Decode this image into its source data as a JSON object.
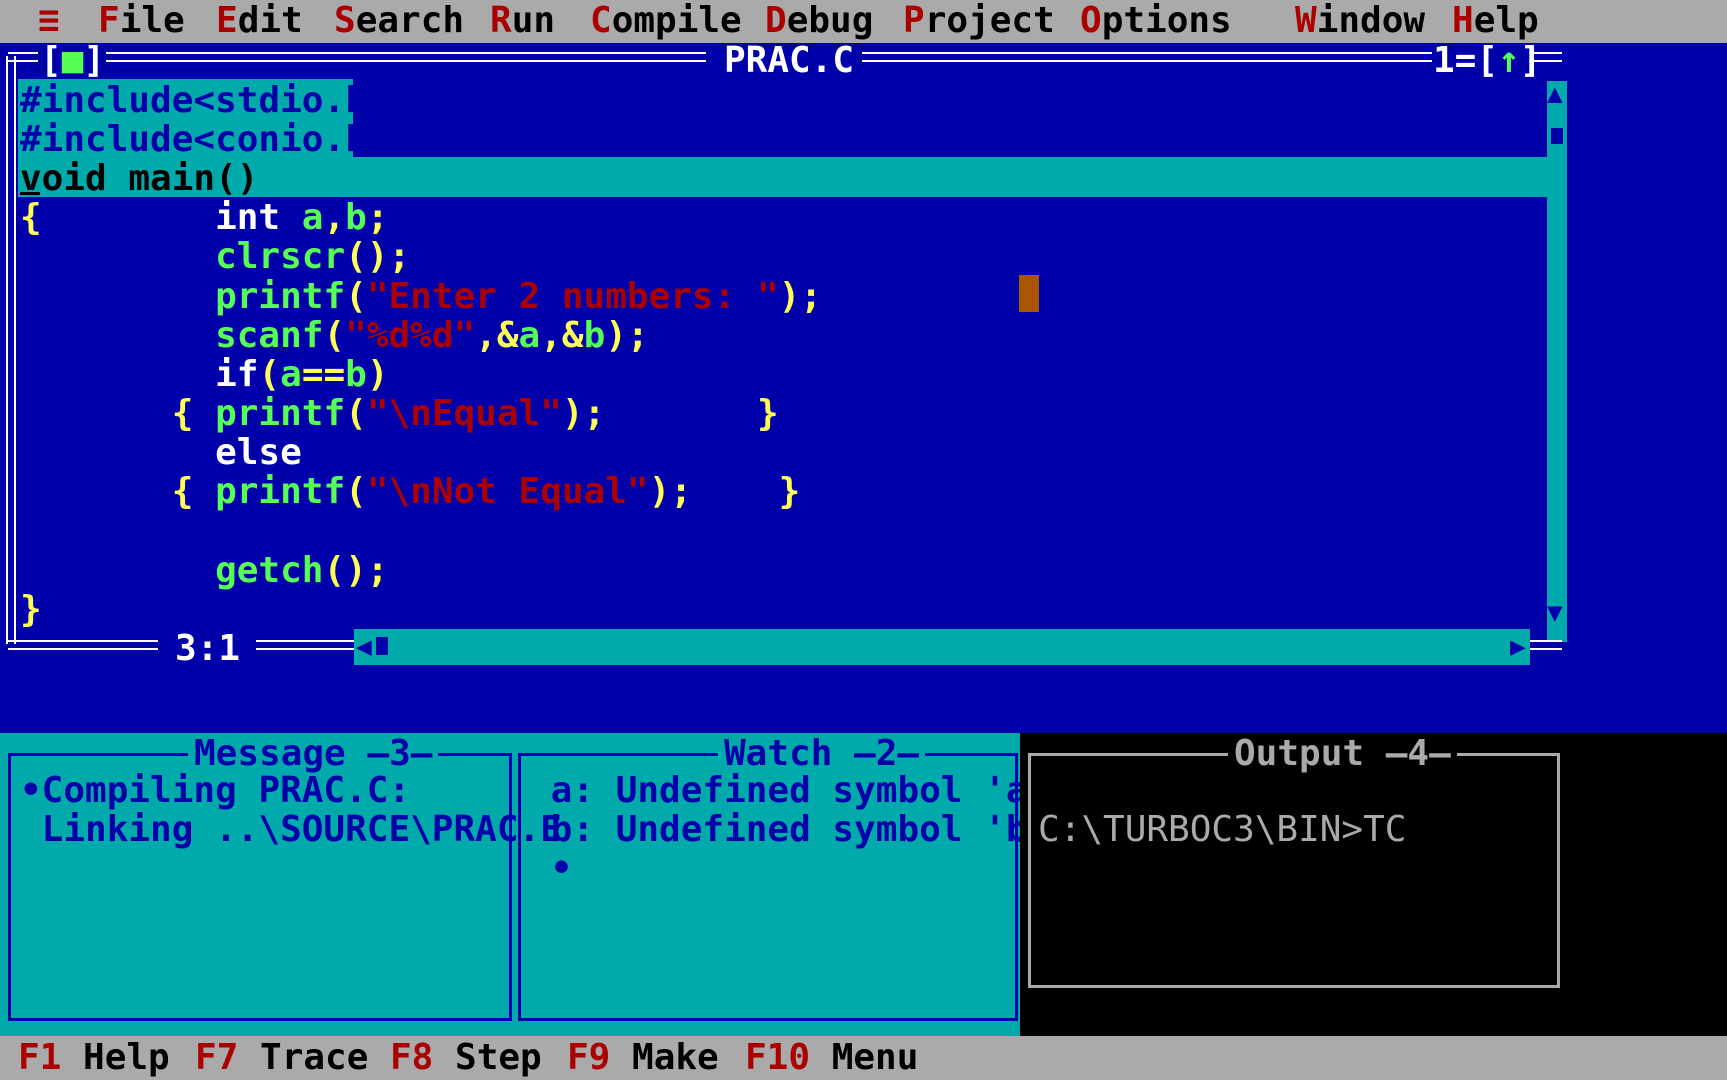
{
  "menubar": {
    "system_icon": "≡",
    "items": [
      {
        "hot": "F",
        "rest": "ile"
      },
      {
        "hot": "E",
        "rest": "dit"
      },
      {
        "hot": "S",
        "rest": "earch"
      },
      {
        "hot": "R",
        "rest": "un"
      },
      {
        "hot": "C",
        "rest": "ompile"
      },
      {
        "hot": "D",
        "rest": "ebug"
      },
      {
        "hot": "P",
        "rest": "roject"
      },
      {
        "hot": "O",
        "rest": "ptions"
      },
      {
        "hot": "W",
        "rest": "indow"
      },
      {
        "hot": "H",
        "rest": "elp"
      }
    ]
  },
  "editor": {
    "title": "PRAC.C",
    "close_box": "[■]",
    "window_number": "1=[↑]",
    "cursor_position": "3:1",
    "lines": [
      "#include<stdio.h>",
      "#include<conio.h>",
      "void main()",
      "{        int a,b;",
      "         clrscr();",
      "         printf(\"Enter 2 numbers: \");",
      "         scanf(\"%d%d\",&a,&b);",
      "         if(a==b)",
      "       { printf(\"\\nEqual\");       }",
      "         else",
      "       { printf(\"\\nNot Equal\");    }",
      "",
      "         getch();",
      "}"
    ]
  },
  "message_panel": {
    "title": "Message",
    "number": "3",
    "lines": [
      "•Compiling PRAC.C:",
      " Linking ..\\SOURCE\\PRAC.E"
    ]
  },
  "watch_panel": {
    "title": "Watch",
    "number": "2",
    "lines": [
      " a: Undefined symbol 'a'",
      " b: Undefined symbol 'b'",
      " •"
    ]
  },
  "output_panel": {
    "title": "Output",
    "number": "4",
    "lines": [
      "C:\\TURBOC3\\BIN>TC"
    ]
  },
  "statusbar": {
    "keys": [
      {
        "key": "F1",
        "label": " Help"
      },
      {
        "key": "F7",
        "label": " Trace"
      },
      {
        "key": "F8",
        "label": " Step"
      },
      {
        "key": "F9",
        "label": " Make"
      },
      {
        "key": "F10",
        "label": " Menu"
      }
    ]
  },
  "colors": {
    "editor_bg": "#0000aa",
    "panel_bg": "#00aaaa",
    "menu_bg": "#aaaaaa",
    "hotkey": "#aa0000",
    "keyword": "#ffffff",
    "identifier": "#55ff55",
    "punct": "#ffff55",
    "string": "#aa0000",
    "cursor": "#aa5500"
  }
}
